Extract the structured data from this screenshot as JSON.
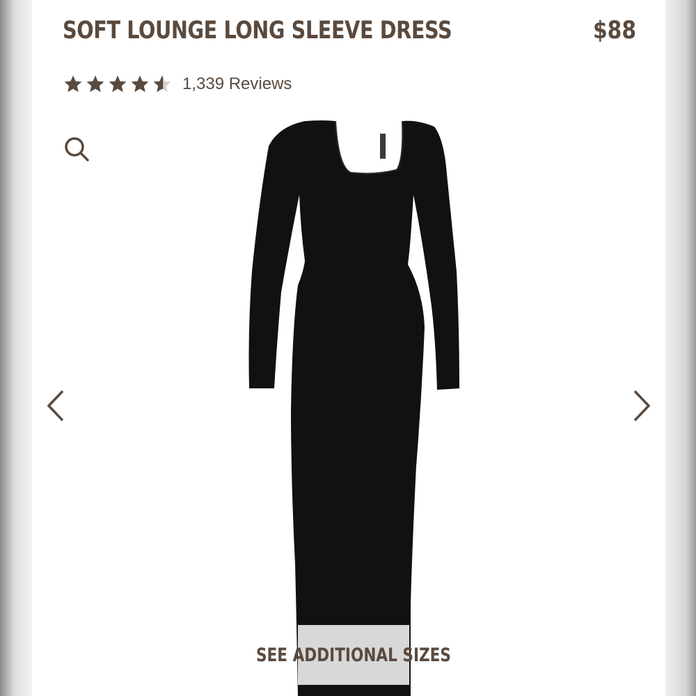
{
  "product": {
    "title": "SOFT LOUNGE LONG SLEEVE DRESS",
    "price": "$88",
    "rating": 4.5,
    "reviews_label": "1,339 Reviews"
  },
  "gallery": {
    "zoom_icon": "search-icon",
    "prev_icon": "chevron-left-icon",
    "next_icon": "chevron-right-icon"
  },
  "sizes_button": {
    "label": "SEE ADDITIONAL SIZES"
  },
  "colors": {
    "text": "#5a4a3e",
    "dress": "#111111",
    "sizes_bg": "#d8d8d8"
  }
}
